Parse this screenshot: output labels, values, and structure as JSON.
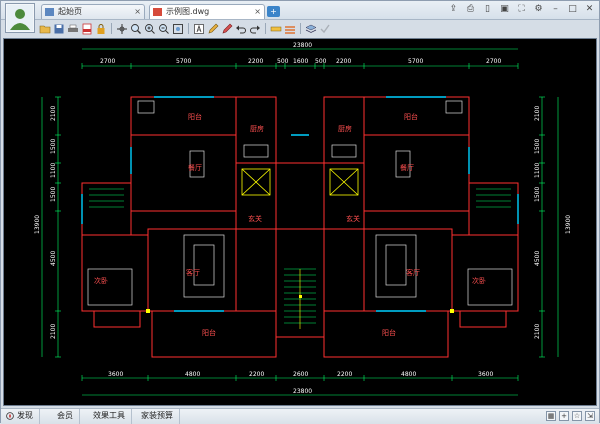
{
  "tabs": [
    {
      "label": "起始页",
      "active": false
    },
    {
      "label": "示例图.dwg",
      "active": true
    }
  ],
  "new_tab_label": "+",
  "window_controls": [
    "share-icon",
    "print-icon",
    "mobile-icon",
    "save-icon",
    "fullscreen-icon",
    "settings-icon",
    "minimize-icon",
    "maximize-icon",
    "close-icon"
  ],
  "drawing": {
    "dims_top_total": "23800",
    "dims_top": [
      "2700",
      "5700",
      "2200",
      "500",
      "1600",
      "500",
      "2200",
      "5700",
      "2700"
    ],
    "dims_bottom": [
      "3600",
      "4800",
      "2200",
      "2600",
      "2200",
      "4800",
      "3600"
    ],
    "dims_bottom_total": "23800",
    "dims_left": [
      "2100",
      "1500",
      "1100",
      "1500",
      "4500",
      "2100"
    ],
    "dims_left_total": "13900",
    "dims_right": [
      "2100",
      "1500",
      "1100",
      "1500",
      "4500",
      "2100"
    ],
    "dims_right_total": "13900",
    "rooms": {
      "balcony_top_left": "阳台",
      "kitchen_left": "厨房",
      "kitchen_right": "厨房",
      "balcony_top_right": "阳台",
      "dining_left": "餐厅",
      "dining_right": "餐厅",
      "entrance_left": "玄关",
      "entrance_right": "玄关",
      "bedroom_left": "次卧",
      "living_left": "客厅",
      "living_right": "客厅",
      "bedroom_right": "次卧",
      "balcony_bottom_left": "阳台",
      "balcony_bottom_right": "阳台"
    }
  },
  "statusbar": {
    "items": [
      "发现",
      "会员",
      "效果工具",
      "家装预算"
    ],
    "right_buttons": [
      "layout-icon",
      "plus-icon",
      "star-icon",
      "export-icon"
    ]
  },
  "colors": {
    "wall": "#ff3030",
    "dimension": "#00ff66",
    "cyan": "#00d0ff",
    "yellow": "#ffff00"
  }
}
